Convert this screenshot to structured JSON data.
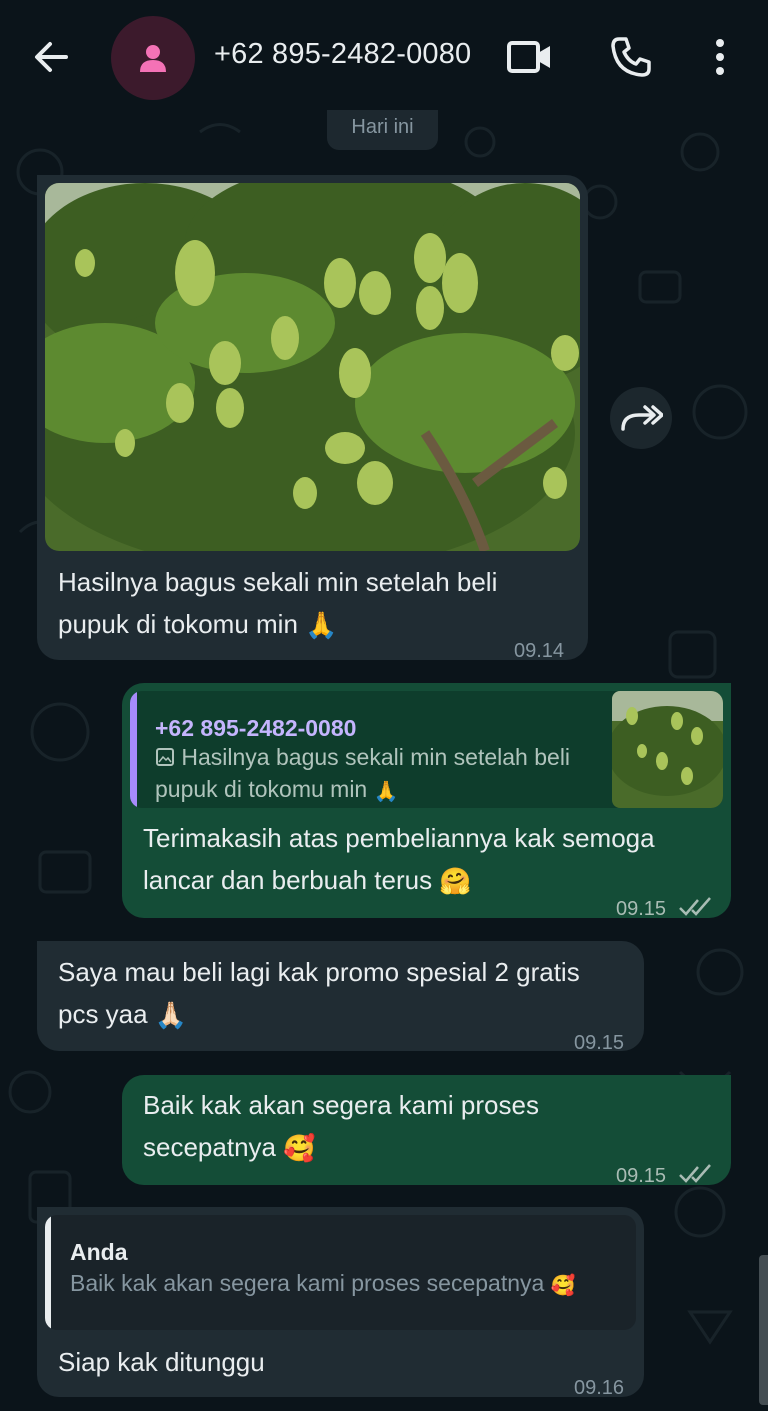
{
  "header": {
    "contact_name": "+62 895-2482-0080",
    "icons": {
      "back": "arrow-left-icon",
      "avatar": "person-icon",
      "video": "video-camera-icon",
      "call": "phone-icon",
      "menu": "more-vertical-icon"
    }
  },
  "date_chip": "Hari ini",
  "messages": [
    {
      "direction": "incoming",
      "has_image": true,
      "image_subject": "mango-tree-photo",
      "text": "Hasilnya bagus sekali min setelah beli pupuk di tokomu min",
      "emoji": "🙏",
      "time": "09.14"
    },
    {
      "direction": "outgoing",
      "quote": {
        "author": "+62 895-2482-0080",
        "text": "Hasilnya bagus sekali min setelah beli pupuk di tokomu min",
        "emoji": "🙏",
        "icon": "image-icon"
      },
      "text": "Terimakasih atas pembeliannya kak semoga lancar dan berbuah terus",
      "emoji": "🤗",
      "time": "09.15",
      "status": "read"
    },
    {
      "direction": "incoming",
      "text": "Saya mau beli lagi kak promo spesial 2 gratis pcs yaa",
      "emoji": "🙏🏻",
      "time": "09.15"
    },
    {
      "direction": "outgoing",
      "text": "Baik kak akan segera kami proses secepatnya",
      "emoji": "🥰",
      "time": "09.15",
      "status": "read"
    },
    {
      "direction": "incoming",
      "quote": {
        "author": "Anda",
        "text": "Baik kak akan segera kami proses secepatnya",
        "emoji": "🥰"
      },
      "text": "Siap kak ditunggu",
      "time": "09.16"
    }
  ],
  "colors": {
    "background": "#0b141a",
    "incoming_bubble": "#202c33",
    "outgoing_bubble": "#144d37",
    "quote_bar_contact": "#a78bfa",
    "timestamp": "#8696a0"
  }
}
